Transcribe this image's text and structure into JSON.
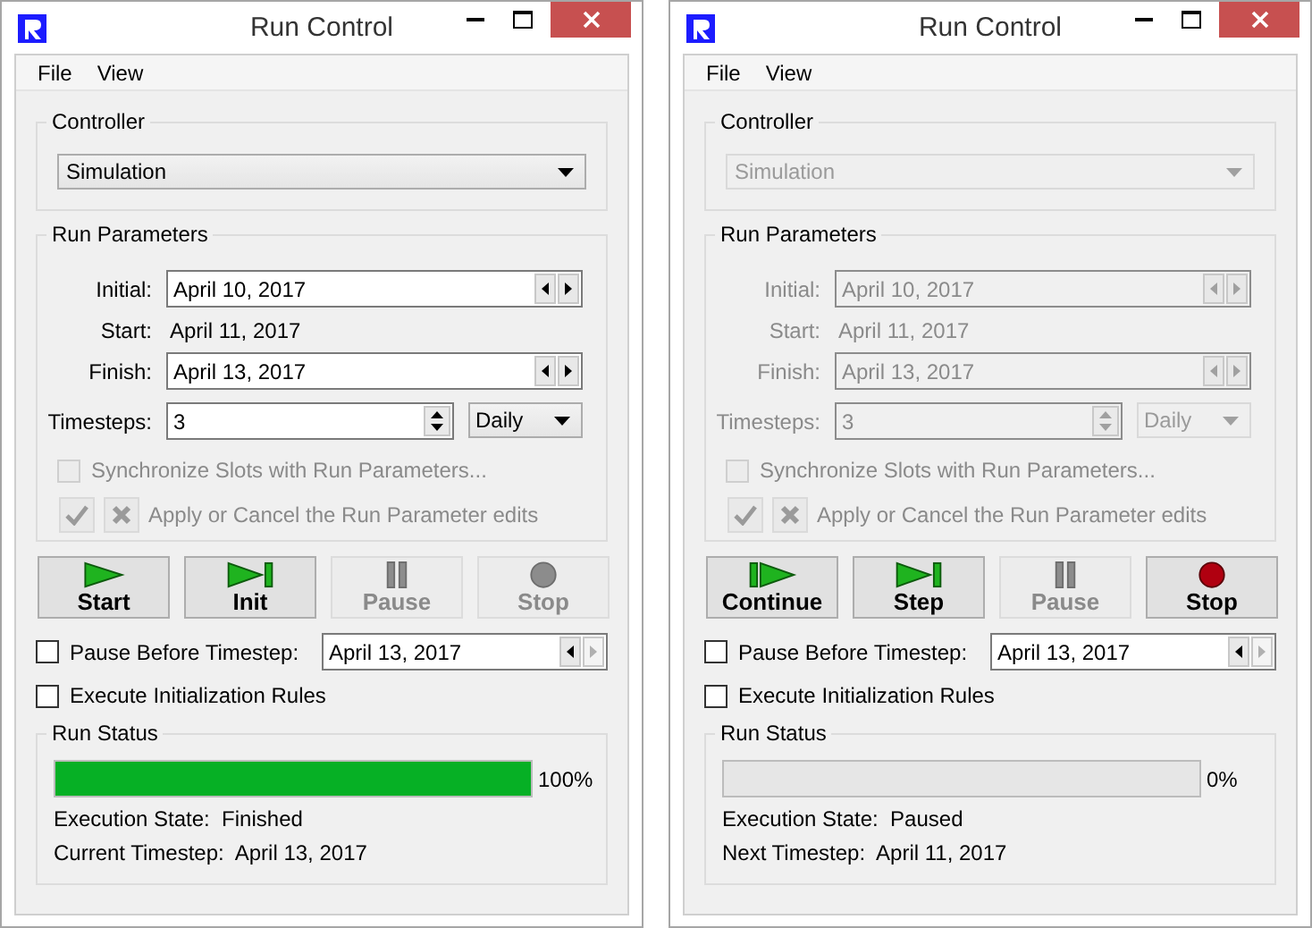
{
  "windows": [
    {
      "title": "Run Control",
      "menu": [
        "File",
        "View"
      ],
      "controller": {
        "label": "Controller",
        "value": "Simulation",
        "disabled": false
      },
      "run_parameters": {
        "title": "Run Parameters",
        "disabled": false,
        "initial": {
          "label": "Initial:",
          "value": "April 10, 2017"
        },
        "start": {
          "label": "Start:",
          "value": "April 11, 2017"
        },
        "finish": {
          "label": "Finish:",
          "value": "April 13, 2017"
        },
        "timesteps": {
          "label": "Timesteps:",
          "value": "3",
          "unit": "Daily"
        },
        "sync": {
          "label": "Synchronize Slots with Run Parameters...",
          "checked": false,
          "disabled": true
        },
        "apply": {
          "label": "Apply or Cancel the Run Parameter edits",
          "disabled": true
        }
      },
      "buttons": [
        {
          "label": "Start",
          "kind": "play",
          "disabled": false
        },
        {
          "label": "Init",
          "kind": "step",
          "disabled": false
        },
        {
          "label": "Pause",
          "kind": "pause",
          "disabled": true
        },
        {
          "label": "Stop",
          "kind": "stop",
          "disabled": true
        }
      ],
      "pause_before": {
        "label": "Pause Before Timestep:",
        "checked": false,
        "value": "April 13, 2017"
      },
      "init_rules": {
        "label": "Execute Initialization Rules",
        "checked": false
      },
      "run_status": {
        "title": "Run Status",
        "level": 1,
        "percent": "100%",
        "state_label": "Execution State:",
        "state_value": "Finished",
        "timestep_label": "Current Timestep:",
        "timestep_value": "April 13, 2017"
      }
    },
    {
      "title": "Run Control",
      "menu": [
        "File",
        "View"
      ],
      "controller": {
        "label": "Controller",
        "value": "Simulation",
        "disabled": true
      },
      "run_parameters": {
        "title": "Run Parameters",
        "disabled": true,
        "initial": {
          "label": "Initial:",
          "value": "April 10, 2017"
        },
        "start": {
          "label": "Start:",
          "value": "April 11, 2017"
        },
        "finish": {
          "label": "Finish:",
          "value": "April 13, 2017"
        },
        "timesteps": {
          "label": "Timesteps:",
          "value": "3",
          "unit": "Daily"
        },
        "sync": {
          "label": "Synchronize Slots with Run Parameters...",
          "checked": false,
          "disabled": true
        },
        "apply": {
          "label": "Apply or Cancel the Run Parameter edits",
          "disabled": true
        }
      },
      "buttons": [
        {
          "label": "Continue",
          "kind": "continue",
          "disabled": false
        },
        {
          "label": "Step",
          "kind": "step",
          "disabled": false
        },
        {
          "label": "Pause",
          "kind": "pause",
          "disabled": true
        },
        {
          "label": "Stop",
          "kind": "stop",
          "disabled": false
        }
      ],
      "pause_before": {
        "label": "Pause Before Timestep:",
        "checked": false,
        "value": "April 13, 2017"
      },
      "init_rules": {
        "label": "Execute Initialization Rules",
        "checked": false
      },
      "run_status": {
        "title": "Run Status",
        "level": 0,
        "percent": "0%",
        "state_label": "Execution State:",
        "state_value": "Paused",
        "timestep_label": "Next Timestep:",
        "timestep_value": "April 11, 2017"
      }
    }
  ]
}
